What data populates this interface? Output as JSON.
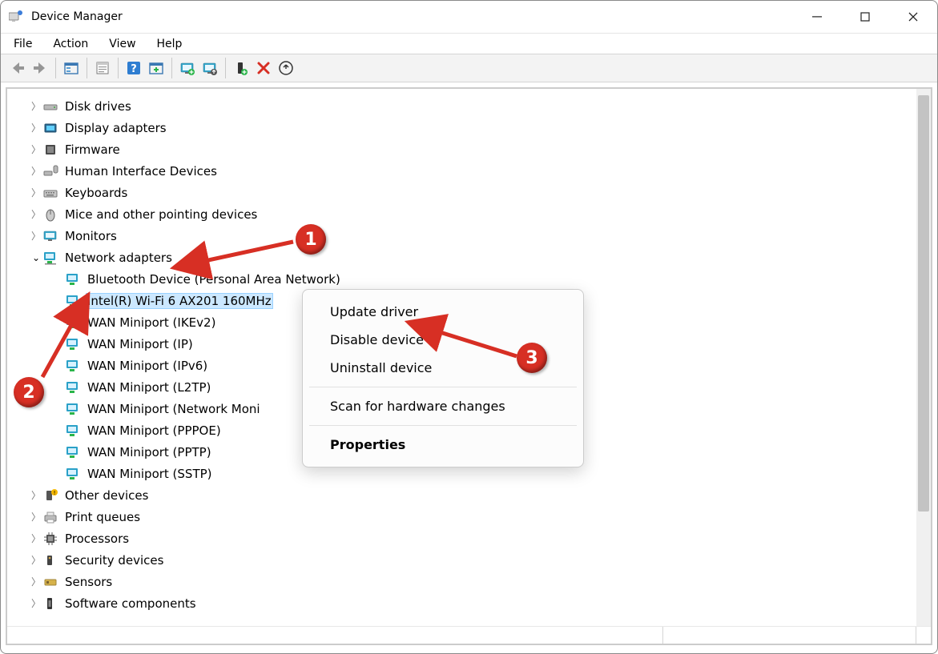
{
  "window": {
    "title": "Device Manager"
  },
  "menu": {
    "file": "File",
    "action": "Action",
    "view": "View",
    "help": "Help"
  },
  "tree": {
    "disk_drives": "Disk drives",
    "display_adapters": "Display adapters",
    "firmware": "Firmware",
    "hid": "Human Interface Devices",
    "keyboards": "Keyboards",
    "mice": "Mice and other pointing devices",
    "monitors": "Monitors",
    "network_adapters": "Network adapters",
    "net_children": {
      "bt": "Bluetooth Device (Personal Area Network)",
      "wifi": "Intel(R) Wi-Fi 6 AX201 160MHz",
      "ikev2": "WAN Miniport (IKEv2)",
      "ip": "WAN Miniport (IP)",
      "ipv6": "WAN Miniport (IPv6)",
      "l2tp": "WAN Miniport (L2TP)",
      "netmon": "WAN Miniport (Network Moni",
      "pppoe": "WAN Miniport (PPPOE)",
      "pptp": "WAN Miniport (PPTP)",
      "sstp": "WAN Miniport (SSTP)"
    },
    "other_devices": "Other devices",
    "print_queues": "Print queues",
    "processors": "Processors",
    "security_devices": "Security devices",
    "sensors": "Sensors",
    "software_components": "Software components"
  },
  "context_menu": {
    "update": "Update driver",
    "disable": "Disable device",
    "uninstall": "Uninstall device",
    "scan": "Scan for hardware changes",
    "properties": "Properties"
  },
  "annotations": {
    "one": "1",
    "two": "2",
    "three": "3"
  }
}
